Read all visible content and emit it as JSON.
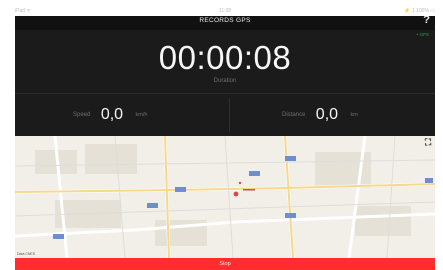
{
  "status_bar": {
    "carrier": "iPad ᯤ",
    "time": "11:08",
    "battery": "⚡ 1 100% ▭"
  },
  "header": {
    "title": "RECORDS GPS",
    "help": "?"
  },
  "timer": {
    "gps": "• GPS",
    "time": "00:00:08",
    "label": "Duration"
  },
  "stats": {
    "speed": {
      "label": "Speed",
      "value": "0,0",
      "unit": "km/h"
    },
    "distance": {
      "label": "Distance",
      "value": "0,0",
      "unit": "km"
    }
  },
  "map": {
    "expand_icon": "expand-icon",
    "credit": "Data CNES"
  },
  "footer": {
    "stop_label": "Stop"
  },
  "colors": {
    "background_dark": "#1b1b1b",
    "header": "#111111",
    "stop": "#ff2d2d",
    "gps": "#2e9c3a"
  }
}
